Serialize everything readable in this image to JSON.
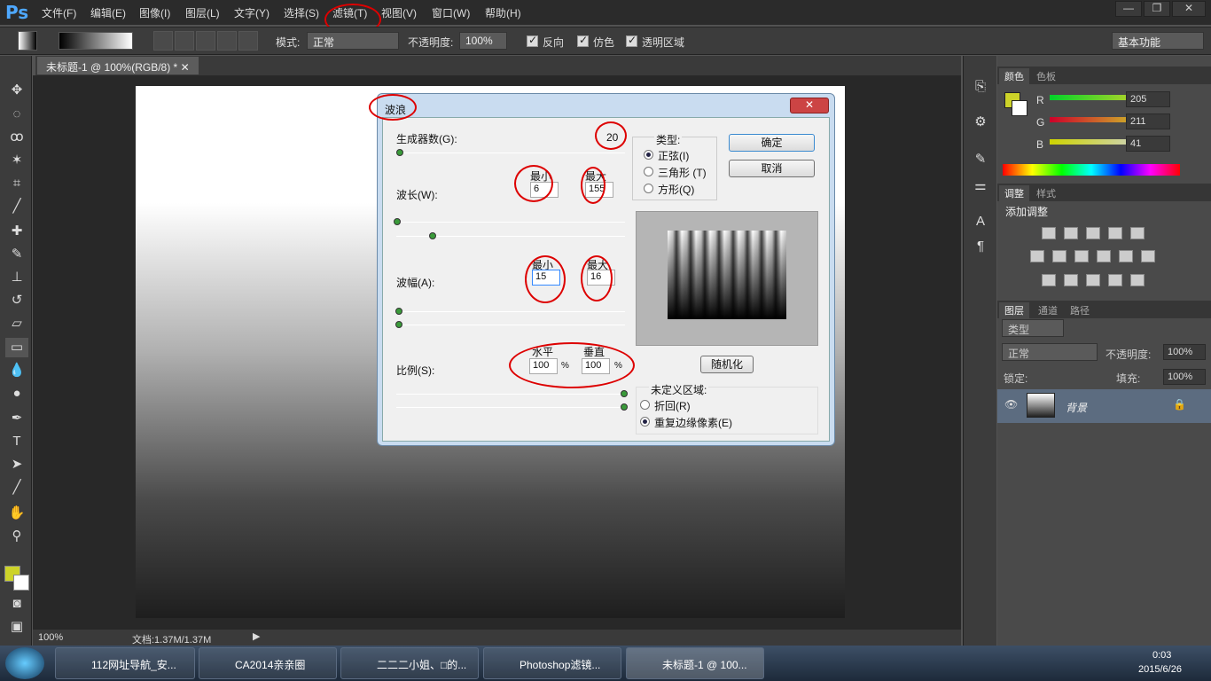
{
  "app": {
    "logo": "Ps",
    "menus": [
      "文件(F)",
      "编辑(E)",
      "图像(I)",
      "图层(L)",
      "文字(Y)",
      "选择(S)",
      "滤镜(T)",
      "视图(V)",
      "窗口(W)",
      "帮助(H)"
    ]
  },
  "options": {
    "mode_label": "模式:",
    "mode_value": "正常",
    "opacity_label": "不透明度:",
    "opacity_value": "100%",
    "reverse": "反向",
    "dither": "仿色",
    "transparency": "透明区域",
    "workspace": "基本功能"
  },
  "document": {
    "tab": "未标题-1 @ 100%(RGB/8) *",
    "zoom": "100%",
    "docinfo": "文档:1.37M/1.37M"
  },
  "color_panel": {
    "tab1": "颜色",
    "tab2": "色板",
    "r_label": "R",
    "g_label": "G",
    "b_label": "B",
    "r": "205",
    "g": "211",
    "b": "41",
    "fg": "#cdd329"
  },
  "adjust_panel": {
    "tab1": "调整",
    "tab2": "样式",
    "title": "添加调整"
  },
  "layers_panel": {
    "tab1": "图层",
    "tab2": "通道",
    "tab3": "路径",
    "kind": "类型",
    "blend": "正常",
    "opacity_label": "不透明度:",
    "opacity": "100%",
    "lock_label": "锁定:",
    "fill_label": "填充:",
    "fill": "100%",
    "layer_name": "背景"
  },
  "dialog": {
    "title": "波浪",
    "close": "✕",
    "generators_label": "生成器数(G):",
    "generators": "20",
    "min": "最小",
    "max": "最大",
    "wavelength_label": "波长(W):",
    "wl_min": "6",
    "wl_max": "155",
    "amplitude_label": "波幅(A):",
    "amp_min": "15",
    "amp_max": "16",
    "scale_label": "比例(S):",
    "horizontal": "水平",
    "vertical": "垂直",
    "scale_h": "100",
    "scale_v": "100",
    "pct": "%",
    "type_label": "类型:",
    "sine": "正弦(I)",
    "triangle": "三角形 (T)",
    "square": "方形(Q)",
    "ok": "确定",
    "cancel": "取消",
    "randomize": "随机化",
    "undefined_label": "未定义区域:",
    "wrap": "折回(R)",
    "repeat": "重复边缘像素(E)"
  },
  "taskbar": {
    "items": [
      "112网址导航_安...",
      "CA2014亲亲圈",
      "二二二小姐、□的...",
      "Photoshop滤镜...",
      "未标题-1 @ 100..."
    ],
    "time": "0:03",
    "date": "2015/6/26"
  }
}
